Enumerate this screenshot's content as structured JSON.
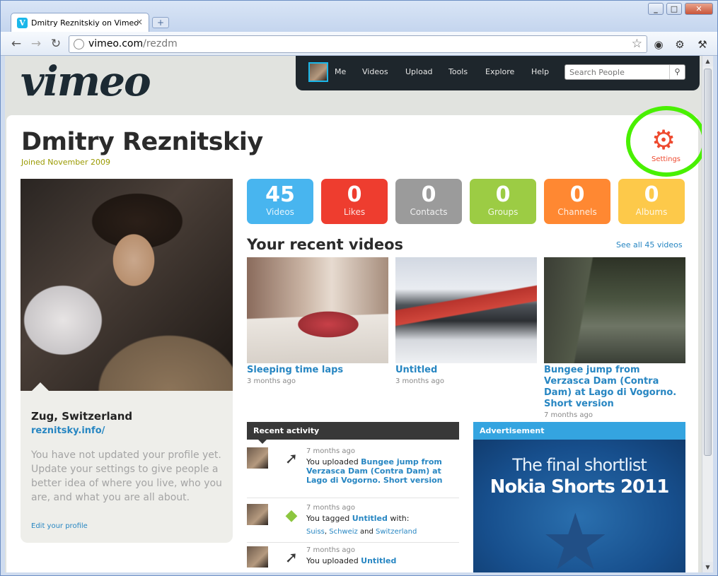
{
  "browser": {
    "tab_title": "Dmitry Reznitskiy on Vimeo",
    "tab_close": "×",
    "new_tab": "+",
    "url_host": "vimeo.com",
    "url_path": "/rezdm",
    "win_min": "_",
    "win_max": "□",
    "win_close": "✕"
  },
  "header": {
    "logo": "vimeo",
    "nav": [
      "Me",
      "Videos",
      "Upload",
      "Tools",
      "Explore",
      "Help"
    ],
    "search_placeholder": "Search People"
  },
  "profile": {
    "name": "Dmitry Reznitskiy",
    "joined": "Joined November 2009",
    "settings_label": "Settings",
    "location": "Zug, Switzerland",
    "website": "reznitsky.info/",
    "description": "You have not updated your profile yet. Update your settings to give people a better idea of where you live, who you are, and what you are all about.",
    "edit_link": "Edit your profile"
  },
  "stats": [
    {
      "count": "45",
      "label": "Videos",
      "color": "#48b5ef"
    },
    {
      "count": "0",
      "label": "Likes",
      "color": "#ee3d2f"
    },
    {
      "count": "0",
      "label": "Contacts",
      "color": "#9b9b9b"
    },
    {
      "count": "0",
      "label": "Groups",
      "color": "#9ccc44"
    },
    {
      "count": "0",
      "label": "Channels",
      "color": "#ff8832"
    },
    {
      "count": "0",
      "label": "Albums",
      "color": "#fdc94a"
    }
  ],
  "recent_videos": {
    "title": "Your recent videos",
    "see_all": "See all 45 videos",
    "items": [
      {
        "title": "Sleeping time laps",
        "age": "3 months ago"
      },
      {
        "title": "Untitled",
        "age": "3 months ago"
      },
      {
        "title": "Bungee jump from Verzasca Dam (Contra Dam) at Lago di Vogorno. Short version",
        "age": "7 months ago"
      }
    ]
  },
  "activity": {
    "title": "Recent activity",
    "items": [
      {
        "when": "7 months ago",
        "prefix": "You uploaded ",
        "link": "Bungee jump from Verzasca Dam (Contra Dam) at Lago di Vogorno. Short version",
        "suffix": ""
      },
      {
        "when": "7 months ago",
        "prefix": "You tagged ",
        "link": "Untitled",
        "suffix": " with:",
        "tags": [
          "Suiss",
          "Schweiz",
          "Switzerland"
        ],
        "tag_sep": ", ",
        "tag_and": " and "
      },
      {
        "when": "7 months ago",
        "prefix": "You uploaded ",
        "link": "Untitled",
        "suffix": ""
      }
    ]
  },
  "advertisement": {
    "title": "Advertisement",
    "line1": "The final shortlist",
    "line2": "Nokia Shorts 2011"
  }
}
